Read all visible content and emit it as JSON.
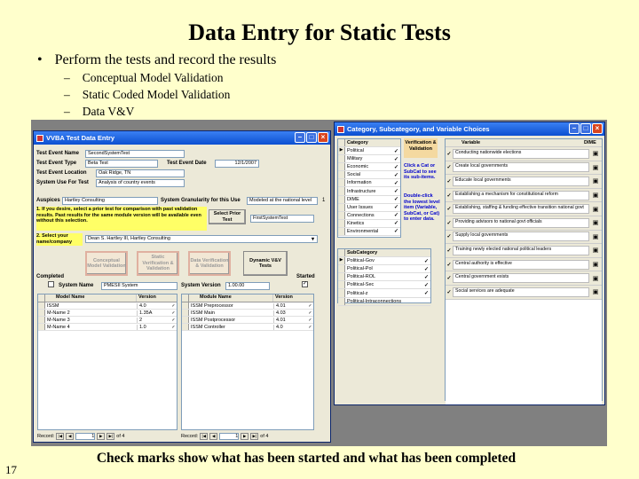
{
  "slide": {
    "title": "Data Entry for Static Tests",
    "bullet": "Perform the tests and record the results",
    "subs": [
      "Conceptual Model Validation",
      "Static Coded Model Validation",
      "Data V&V"
    ],
    "caption": "Check marks show what has been started and what has been completed",
    "number": "17",
    "bullet_glyph": "•",
    "dash_glyph": "–"
  },
  "left_window": {
    "title": "VVBA Test Data Entry",
    "fields": {
      "event_name_label": "Test Event Name",
      "event_name": "SecondSystemTest",
      "event_type_label": "Test Event Type",
      "event_type": "Beta Test",
      "event_date_label": "Test Event Date",
      "event_date": "12/1/2007",
      "location_label": "Test Event Location",
      "location": "Oak Ridge, TN",
      "system_use_label": "System Use For Test",
      "system_use": "Analysis of country events",
      "auspices_label": "Auspices",
      "auspices": "Hartley Consulting",
      "granularity_label": "System Granularity for this Use",
      "granularity": "Modeled at the national level",
      "granularity_num": "1",
      "prior_note": "1. If you desire, select a prior test for comparison with past validation results. Past results for the same module version will be available even without this selection.",
      "select_prior_button": "Select Prior Test",
      "prior_test": "FirstSystemTest",
      "name_note": "2. Select your name/company",
      "name_company": "Dean S. Hartley III, Hartley Consulting",
      "conceptual_button": "Conceptual Model Validation",
      "static_button": "Static Verification & Validation",
      "data_button": "Data Verification & Validation",
      "dynamic_button": "Dynamic V&V Tests",
      "completed_label": "Completed",
      "started_label": "Started",
      "system_name_label": "System Name",
      "system_name": "PMESII System",
      "system_version_label": "System Version",
      "system_version": "1.00.00"
    },
    "model_grid": {
      "headers": [
        "Model Name",
        "Version"
      ],
      "rows": [
        [
          "ISSM",
          "4.0"
        ],
        [
          "M-Name 2",
          "1.35A"
        ],
        [
          "M-Name 3",
          "2"
        ],
        [
          "M-Name 4",
          "1.0"
        ]
      ]
    },
    "module_grid": {
      "headers": [
        "Module Name",
        "Version"
      ],
      "rows": [
        [
          "ISSM Preprocessor",
          "4.01"
        ],
        [
          "ISSM Main",
          "4.03"
        ],
        [
          "ISSM Postprocessor",
          "4.01"
        ],
        [
          "ISSM Controller",
          "4.0"
        ]
      ]
    },
    "record_label": "Record:",
    "record_num": "1",
    "record_of": "of 4"
  },
  "right_window": {
    "title": "Category, Subcategory, and Variable Choices",
    "category_header": "Category",
    "categories": [
      "Political",
      "Military",
      "Economic",
      "Social",
      "Information",
      "Infrastructure",
      "DIME",
      "User Issues",
      "Connections",
      "Kinetics",
      "Environmental"
    ],
    "vv_header": "Verification & Validation",
    "help_note1": "Click a Cat or SubCat to see its sub-items.",
    "help_note2": "Double-click the lowest level item (Variable, SubCat, or Cat) to enter data.",
    "subcategory_header": "SubCategory",
    "subcategories": [
      "Political-Gov",
      "Political-Pol",
      "Political-ROL",
      "Political-Sec",
      "Political-z",
      "Political-Intraconnections"
    ],
    "variable_header": "Variable",
    "dime_header": "DIME",
    "variables": [
      "Conducting nationwide elections",
      "Create local governments",
      "Educate local governments",
      "Establishing a mechanism for constitutional reform",
      "Establishing, staffing & funding effective transition national govt",
      "Providing advisors to national govt officials",
      "Supply local governments",
      "Training newly elected national political leaders",
      "Central authority is effective",
      "Central government exists",
      "Social services are adequate"
    ]
  },
  "colors": {
    "slide_bg": "#ffffcc",
    "titlebar": "#0b4fd1",
    "note_bg": "#ffff66"
  },
  "icons": {
    "check": "✓",
    "row_selector": "▶",
    "dropdown": "▾",
    "dime": "document-icon"
  }
}
